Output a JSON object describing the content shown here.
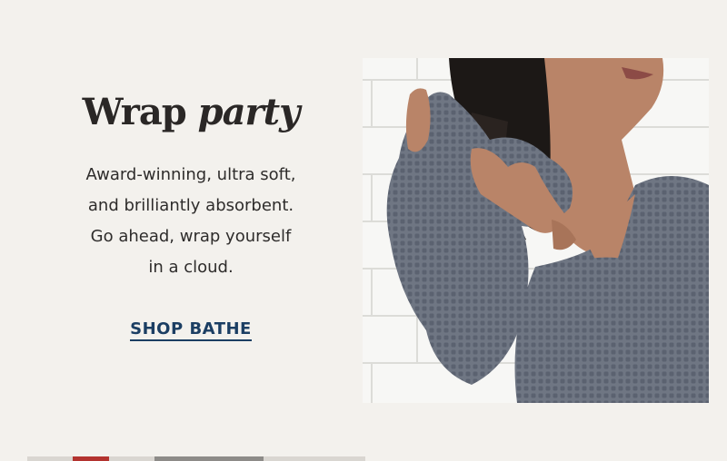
{
  "promo": {
    "headline_part1": "Wrap",
    "headline_part2": "party",
    "body_lines": [
      "Award-winning, ultra soft,",
      "and brilliantly absorbent.",
      "Go ahead, wrap yourself",
      "in a cloud."
    ],
    "cta_label": "SHOP BATHE"
  },
  "colors": {
    "background": "#f3f1ed",
    "text": "#2c2a28",
    "cta": "#1b3e63",
    "robe": "#6e7582"
  }
}
